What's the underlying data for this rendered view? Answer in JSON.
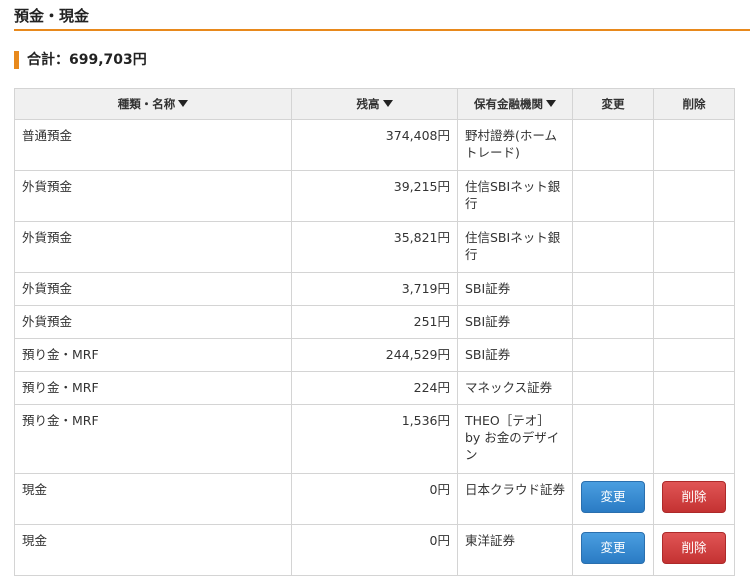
{
  "section": {
    "title": "預金・現金"
  },
  "total": {
    "text": "合計：699,703円"
  },
  "table": {
    "headers": {
      "type": "種類・名称",
      "balance": "残高",
      "institution": "保有金融機関",
      "edit": "変更",
      "delete": "削除"
    },
    "rows": [
      {
        "type": "普通預金",
        "amount": "374,408円",
        "institution": "野村證券(ホームトレード)",
        "edit": "",
        "delete": ""
      },
      {
        "type": "外貨預金",
        "amount": "39,215円",
        "institution": "住信SBIネット銀行",
        "edit": "",
        "delete": ""
      },
      {
        "type": "外貨預金",
        "amount": "35,821円",
        "institution": "住信SBIネット銀行",
        "edit": "",
        "delete": ""
      },
      {
        "type": "外貨預金",
        "amount": "3,719円",
        "institution": "SBI証券",
        "edit": "",
        "delete": ""
      },
      {
        "type": "外貨預金",
        "amount": "251円",
        "institution": "SBI証券",
        "edit": "",
        "delete": ""
      },
      {
        "type": "預り金・MRF",
        "amount": "244,529円",
        "institution": "SBI証券",
        "edit": "",
        "delete": ""
      },
      {
        "type": "預り金・MRF",
        "amount": "224円",
        "institution": "マネックス証券",
        "edit": "",
        "delete": ""
      },
      {
        "type": "預り金・MRF",
        "amount": "1,536円",
        "institution": "THEO［テオ］by お金のデザイン",
        "edit": "",
        "delete": ""
      },
      {
        "type": "現金",
        "amount": "0円",
        "institution": "日本クラウド証券",
        "edit": "変更",
        "delete": "削除"
      },
      {
        "type": "現金",
        "amount": "0円",
        "institution": "東洋証券",
        "edit": "変更",
        "delete": "削除"
      }
    ]
  },
  "colors": {
    "accent": "#e8891c",
    "edit_button": "#2a7bc4",
    "delete_button": "#c43232",
    "header_bg": "#f0f0f0"
  },
  "icons": {
    "sort": "sort-down-triangle-icon"
  }
}
